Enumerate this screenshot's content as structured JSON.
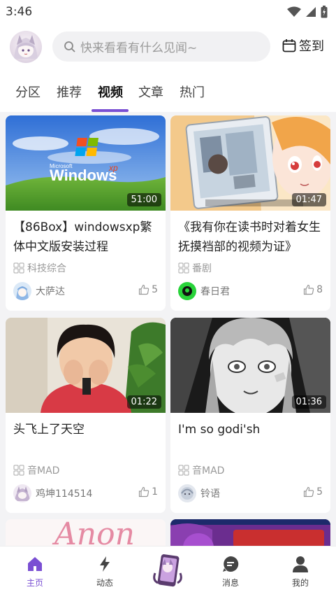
{
  "status_bar": {
    "time": "3:46"
  },
  "header": {
    "search_placeholder": "快来看看有什么见闻~",
    "signin_label": "签到"
  },
  "tabs": [
    {
      "label": "分区"
    },
    {
      "label": "推荐"
    },
    {
      "label": "视频"
    },
    {
      "label": "文章"
    },
    {
      "label": "热门"
    }
  ],
  "active_tab": "视频",
  "accent_color": "#7a4fd3",
  "cards": [
    {
      "title": "【86Box】windowsxp繁体中文版安装过程",
      "duration": "51:00",
      "category": "科技综合",
      "author": "大萨达",
      "likes": "5"
    },
    {
      "title": "《我有你在读书时对着女生抚摸裆部的视频为证》",
      "duration": "01:47",
      "category": "番剧",
      "author": "春日君",
      "likes": "8"
    },
    {
      "title": "头飞上了天空",
      "duration": "01:22",
      "category": "音MAD",
      "author": "鸡坤114514",
      "likes": "1"
    },
    {
      "title": "I'm so godi'sh",
      "duration": "01:36",
      "category": "音MAD",
      "author": "铃语",
      "likes": "5"
    }
  ],
  "thumb_texts": {
    "windows_brand": "Windows",
    "windows_xp": "xp",
    "microsoft": "Microsoft",
    "anon_text": "Anon"
  },
  "bottom_nav": [
    {
      "label": "主页",
      "icon": "home-icon"
    },
    {
      "label": "动态",
      "icon": "lightning-icon"
    },
    {
      "label": "",
      "icon": "center-mascot-icon"
    },
    {
      "label": "消息",
      "icon": "message-icon"
    },
    {
      "label": "我的",
      "icon": "profile-icon"
    }
  ]
}
